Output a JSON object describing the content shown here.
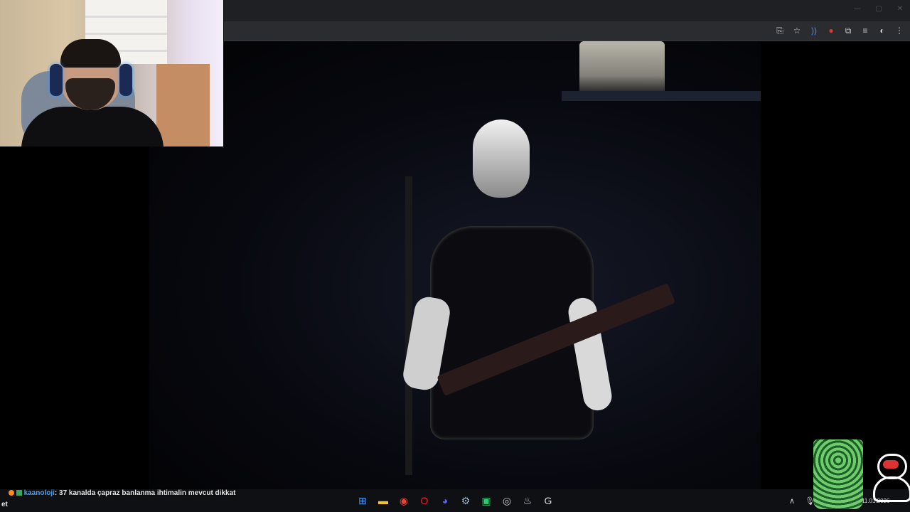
{
  "browser": {
    "window_controls": [
      "—",
      "▢",
      "✕"
    ],
    "toolbar_icons": [
      {
        "name": "install-app-icon",
        "glyph": "⎘"
      },
      {
        "name": "bookmark-star-icon",
        "glyph": "☆"
      },
      {
        "name": "audio-extension-icon",
        "glyph": "))"
      },
      {
        "name": "red-extension-icon",
        "glyph": "●"
      },
      {
        "name": "extensions-puzzle-icon",
        "glyph": "⧉"
      },
      {
        "name": "media-controls-icon",
        "glyph": "≡"
      },
      {
        "name": "profile-avatar-icon",
        "glyph": "◐"
      },
      {
        "name": "menu-kebab-icon",
        "glyph": "⋮"
      }
    ]
  },
  "chat": {
    "username": "kaanoloji",
    "message": ": 37 kanalda çapraz banlanma ihtimalin mevcut dikkat",
    "continuation": "et",
    "colors": {
      "username": "#4aa3ff",
      "badge_1": "#ff8c1a",
      "badge_2": "#3aa55d"
    }
  },
  "taskbar": {
    "apps": [
      {
        "name": "windows-start-icon",
        "glyph": "⊞",
        "color": "#4a9cff"
      },
      {
        "name": "file-explorer-icon",
        "glyph": "▬",
        "color": "#f2c230"
      },
      {
        "name": "chrome-icon",
        "glyph": "◉",
        "color": "#e94235"
      },
      {
        "name": "opera-icon",
        "glyph": "O",
        "color": "#ff1b2d"
      },
      {
        "name": "discord-icon",
        "glyph": "◕",
        "color": "#5865f2"
      },
      {
        "name": "app-settings-icon",
        "glyph": "⚙",
        "color": "#9fb4cf"
      },
      {
        "name": "green-app-icon",
        "glyph": "▣",
        "color": "#2ecc71"
      },
      {
        "name": "obs-icon",
        "glyph": "◎",
        "color": "#cccccc"
      },
      {
        "name": "steam-icon",
        "glyph": "♨",
        "color": "#c7d5e0"
      },
      {
        "name": "logitech-g-icon",
        "glyph": "G",
        "color": "#dddddd"
      }
    ],
    "tray": [
      {
        "name": "tray-chevron-icon",
        "glyph": "∧"
      },
      {
        "name": "microphone-icon",
        "glyph": "🎙"
      }
    ],
    "date": "11.01.2026"
  }
}
